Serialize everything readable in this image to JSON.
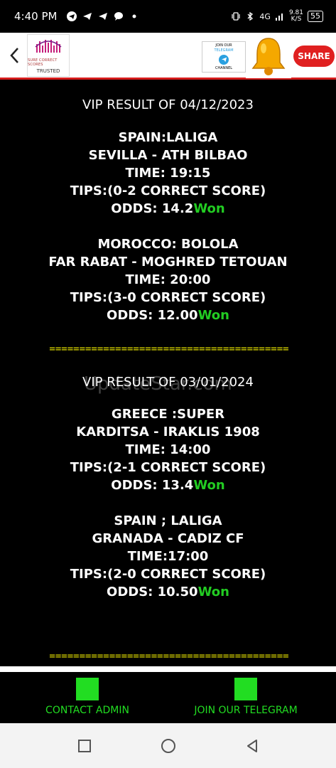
{
  "status_bar": {
    "time": "4:40 PM",
    "network": "4G",
    "speed_value": "9.81",
    "speed_unit": "K/S",
    "battery": "55"
  },
  "header": {
    "logo_sub": "SURE CORRECT SCORES",
    "logo_trusted": "TRUSTED",
    "join_line1": "JOIN OUR",
    "join_line2": "TELEGRAM",
    "join_line3": "CHANNEL",
    "share_label": "SHARE"
  },
  "results": [
    {
      "title": "VIP RESULT OF 04/12/2023",
      "matches": [
        {
          "league": "SPAIN:LALIGA",
          "teams": "SEVILLA - ATH BILBAO",
          "time": "TIME: 19:15",
          "tips": "TIPS:(0-2 CORRECT SCORE)",
          "odds": "ODDS: 14.2",
          "status": "Won"
        },
        {
          "league": "MOROCCO: BOLOLA",
          "teams": "FAR RABAT - MOGHRED TETOUAN",
          "time": "TIME: 20:00",
          "tips": "TIPS:(3-0 CORRECT SCORE)",
          "odds": "ODDS: 12.00",
          "status": "Won"
        }
      ]
    },
    {
      "title": "VIP RESULT OF 03/01/2024",
      "matches": [
        {
          "league": "GREECE :SUPER",
          "teams": "KARDITSA - IRAKLIS 1908",
          "time": "TIME: 14:00",
          "tips": "TIPS:(2-1 CORRECT SCORE)",
          "odds": "ODDS: 13.4",
          "status": "Won"
        },
        {
          "league": "SPAIN ; LALIGA",
          "teams": "GRANADA - CADIZ CF",
          "time": "TIME:17:00",
          "tips": "TIPS:(2-0 CORRECT SCORE)",
          "odds": "ODDS: 10.50",
          "status": "Won"
        }
      ]
    }
  ],
  "divider": "========================================",
  "watermark": "UpdateStar.com",
  "bottom_bar": {
    "contact_label": "CONTACT ADMIN",
    "telegram_label": "JOIN OUR TELEGRAM"
  },
  "colors": {
    "won": "#22cc22",
    "divider": "#e5e000",
    "header_border": "#d61c1c",
    "action_green": "#22dd22"
  }
}
